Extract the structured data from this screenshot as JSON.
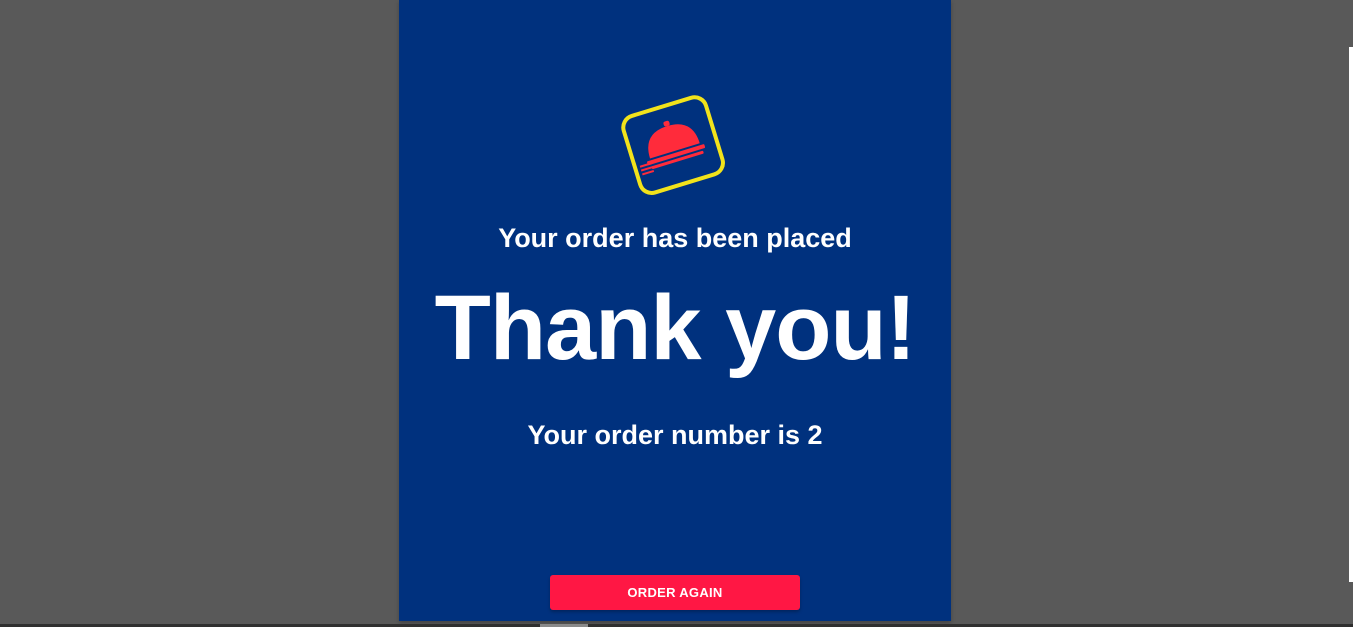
{
  "confirmation": {
    "subtitle": "Your order has been placed",
    "headline": "Thank you!",
    "order_number_text": "Your order number is 2",
    "order_again_label": "ORDER AGAIN"
  },
  "logo": {
    "icon": "food-cloche-icon",
    "frame_color": "#f2e31b",
    "cloche_color": "#ff2b3b"
  },
  "colors": {
    "backdrop": "#595959",
    "card": "#00317e",
    "text": "#ffffff",
    "accent_button": "#ff1744"
  }
}
